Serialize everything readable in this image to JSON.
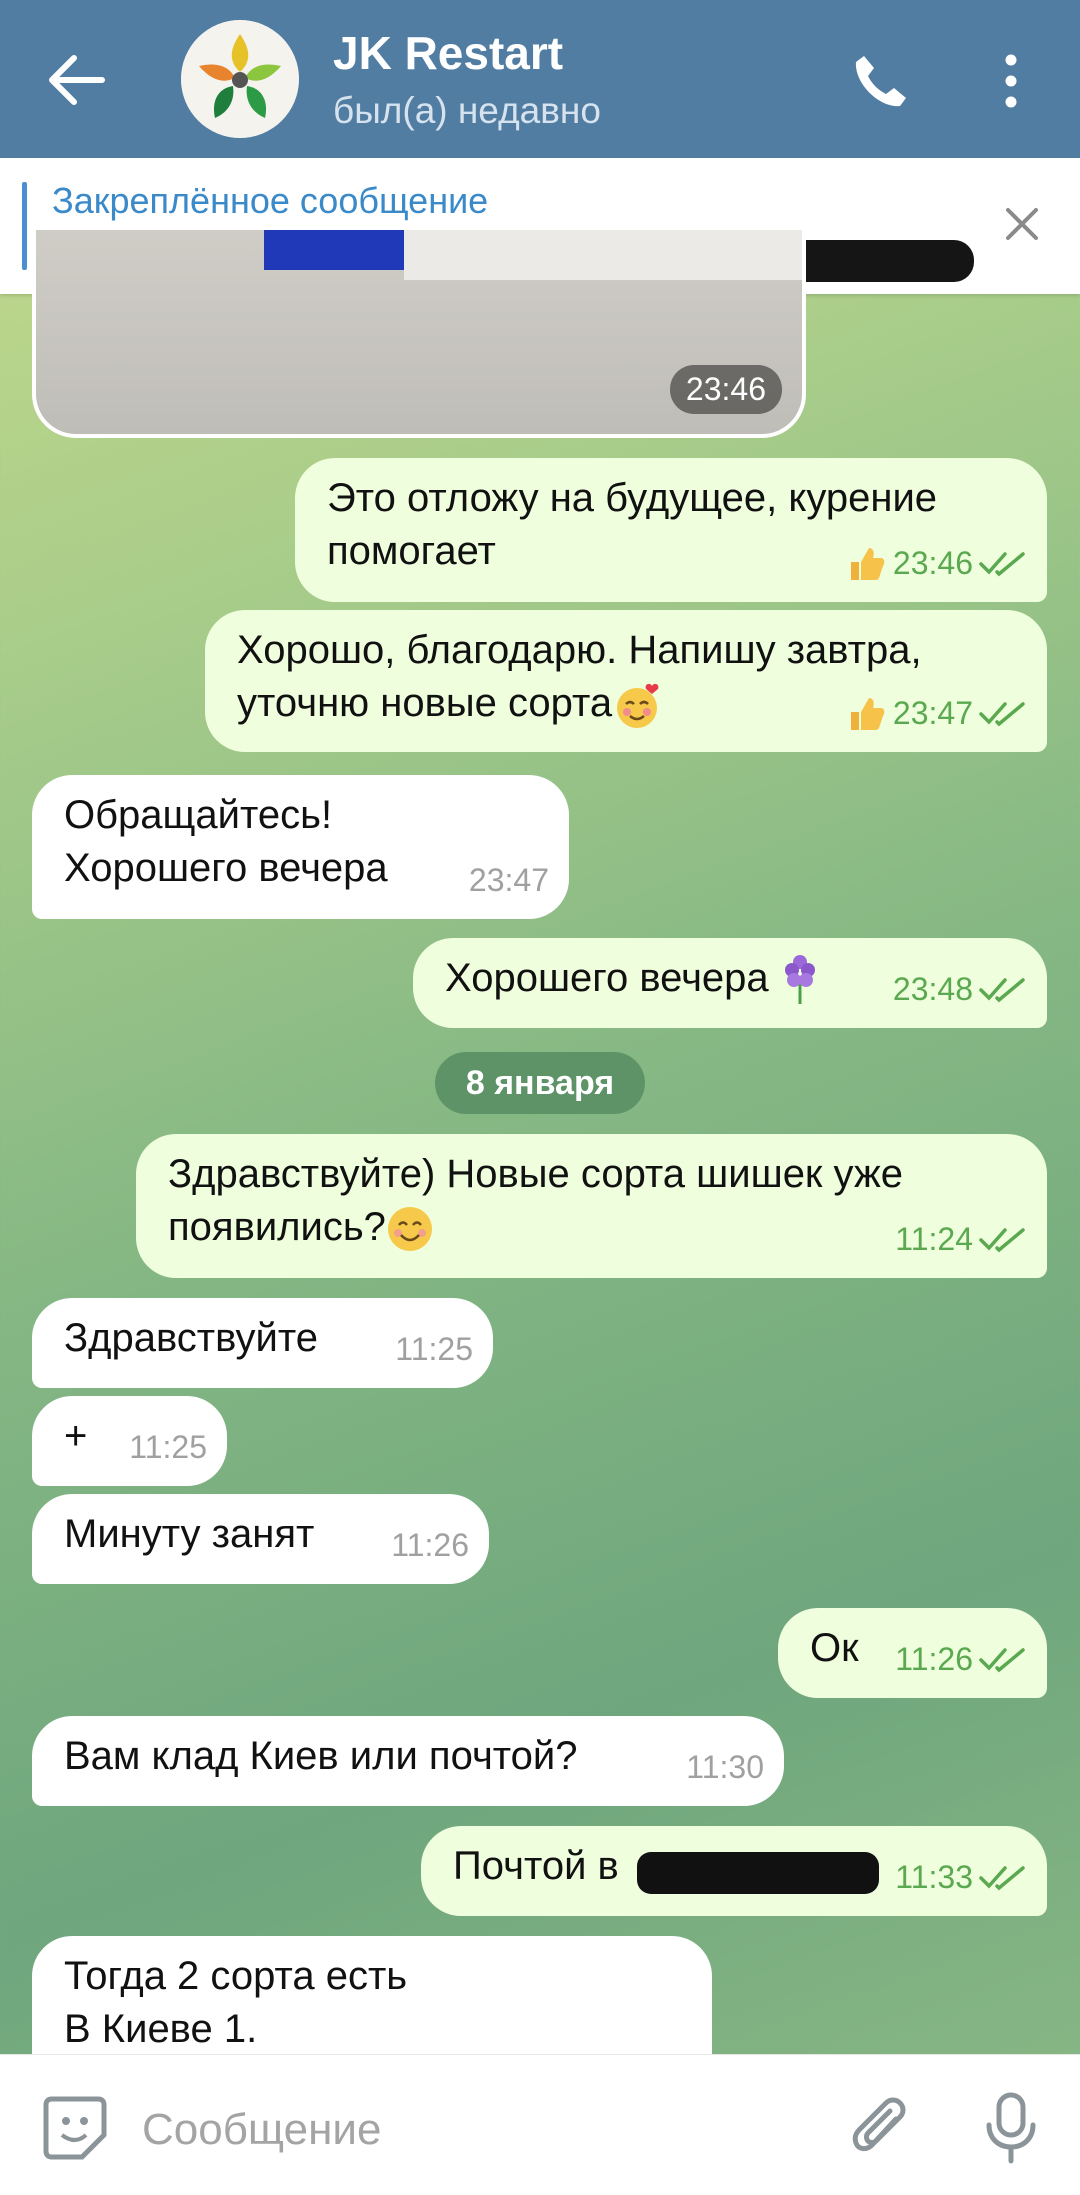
{
  "header": {
    "title": "JK Restart",
    "status": "был(а) недавно"
  },
  "pinned": {
    "title": "Закреплённое сообщение"
  },
  "photo": {
    "time": "23:46"
  },
  "messages": [
    {
      "line1": "Это отложу на будущее, курение",
      "line2": "помогает",
      "time": "23:46"
    },
    {
      "line1": "Хорошо, благодарю. Напишу завтра,",
      "line2": "уточню новые сорта",
      "time": "23:47"
    },
    {
      "line1": "Обращайтесь!",
      "line2": "Хорошего вечера",
      "time": "23:47"
    },
    {
      "line1": "Хорошего вечера",
      "time": "23:48"
    },
    {
      "line1": "Здравствуйте) Новые сорта шишек уже",
      "line2": "появились?",
      "time": "11:24"
    },
    {
      "line1": "Здравствуйте",
      "time": "11:25"
    },
    {
      "line1": "+",
      "time": "11:25"
    },
    {
      "line1": "Минуту занят",
      "time": "11:26"
    },
    {
      "line1": "Ок",
      "time": "11:26"
    },
    {
      "line1": "Вам клад Киев или почтой?",
      "time": "11:30"
    },
    {
      "line1": "Почтой в",
      "time": "11:33"
    },
    {
      "line1": "Тогда 2 сорта есть",
      "line2": "В Киеве 1."
    }
  ],
  "date_divider": "8 января",
  "composer": {
    "placeholder": "Сообщение"
  },
  "colors": {
    "header": "#527da3",
    "outgoing": "#effedd",
    "incoming": "#ffffff",
    "accent": "#3a89c9"
  },
  "icons": [
    "back-arrow-icon",
    "phone-icon",
    "more-vertical-icon",
    "close-icon",
    "thumbs-up-icon",
    "double-check-icon",
    "sticker-icon",
    "paperclip-icon",
    "microphone-icon"
  ]
}
